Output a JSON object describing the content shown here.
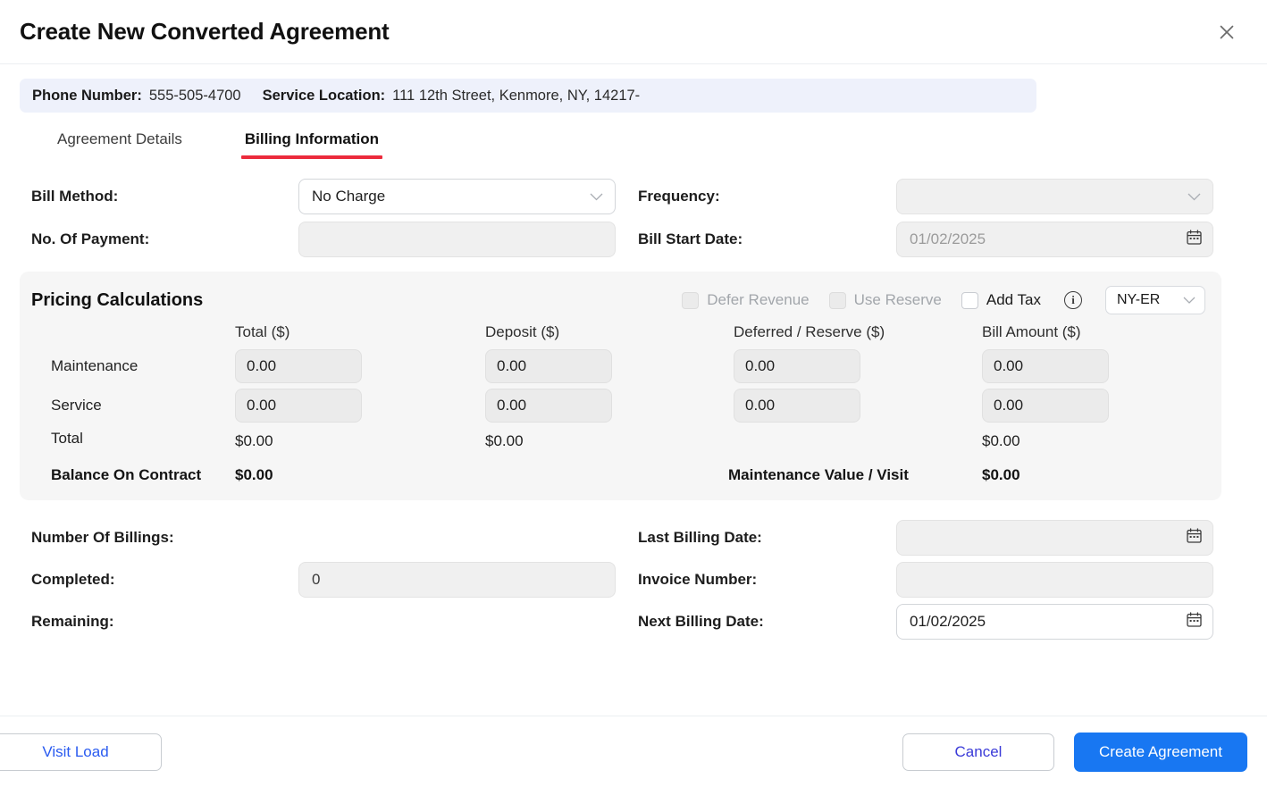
{
  "header": {
    "title": "Create New Converted Agreement",
    "close_icon": "close-icon"
  },
  "info_bar": {
    "phone_label": "Phone Number:",
    "phone_value": "555-505-4700",
    "location_label": "Service Location:",
    "location_value": "111 12th Street, Kenmore, NY, 14217-"
  },
  "tabs": [
    {
      "label": "Agreement Details",
      "active": false
    },
    {
      "label": "Billing Information",
      "active": true
    }
  ],
  "top_form": {
    "bill_method": {
      "label": "Bill Method:",
      "value": "No Charge",
      "placeholder": "",
      "enabled": true,
      "control": "select"
    },
    "frequency": {
      "label": "Frequency:",
      "value": "",
      "placeholder": "",
      "enabled": false,
      "control": "select"
    },
    "no_of_payment": {
      "label": "No. Of Payment:",
      "value": "",
      "placeholder": "",
      "enabled": false,
      "control": "text"
    },
    "bill_start_date": {
      "label": "Bill Start Date:",
      "value": "",
      "placeholder": "01/02/2025",
      "enabled": false,
      "control": "date"
    }
  },
  "pricing": {
    "title": "Pricing Calculations",
    "options": [
      {
        "label": "Defer Revenue",
        "checked": false,
        "enabled": false
      },
      {
        "label": "Use Reserve",
        "checked": false,
        "enabled": false
      },
      {
        "label": "Add Tax",
        "checked": false,
        "enabled": true
      }
    ],
    "info_icon": "info-icon",
    "tax_code": "NY-ER",
    "columns": [
      "",
      "Total ($)",
      "Deposit ($)",
      "Deferred / Reserve ($)",
      "Bill Amount ($)"
    ],
    "rows": [
      {
        "label": "Maintenance",
        "total": "0.00",
        "deposit": "0.00",
        "deferred": "0.00",
        "bill_amount": "0.00"
      },
      {
        "label": "Service",
        "total": "0.00",
        "deposit": "0.00",
        "deferred": "0.00",
        "bill_amount": "0.00"
      }
    ],
    "totals": {
      "label": "Total",
      "total": "$0.00",
      "deposit": "$0.00",
      "deferred": "",
      "bill_amount": "$0.00"
    },
    "balance_label": "Balance On Contract",
    "balance_value": "$0.00",
    "maint_value_label": "Maintenance Value / Visit",
    "maint_value_value": "$0.00"
  },
  "bottom_form": {
    "number_of_billings": {
      "label": "Number Of Billings:",
      "value": "",
      "has_control": false
    },
    "last_billing_date": {
      "label": "Last Billing Date:",
      "value": "",
      "placeholder": "",
      "enabled": false,
      "control": "date"
    },
    "completed": {
      "label": "Completed:",
      "value": "0",
      "placeholder": "",
      "enabled": false,
      "control": "text"
    },
    "invoice_number": {
      "label": "Invoice Number:",
      "value": "",
      "placeholder": "",
      "enabled": false,
      "control": "text"
    },
    "remaining": {
      "label": "Remaining:",
      "value": "",
      "has_control": false
    },
    "next_billing_date": {
      "label": "Next Billing Date:",
      "value": "01/02/2025",
      "placeholder": "",
      "enabled": true,
      "control": "date"
    }
  },
  "footer": {
    "visit_load": "Visit Load",
    "cancel": "Cancel",
    "create": "Create Agreement"
  },
  "colors": {
    "accent_tab": "#ec2b3c",
    "primary_button": "#1877f2",
    "link_blue": "#2a5bf0",
    "info_bar_bg": "#eef1fb",
    "panel_bg": "#f6f6f6"
  }
}
